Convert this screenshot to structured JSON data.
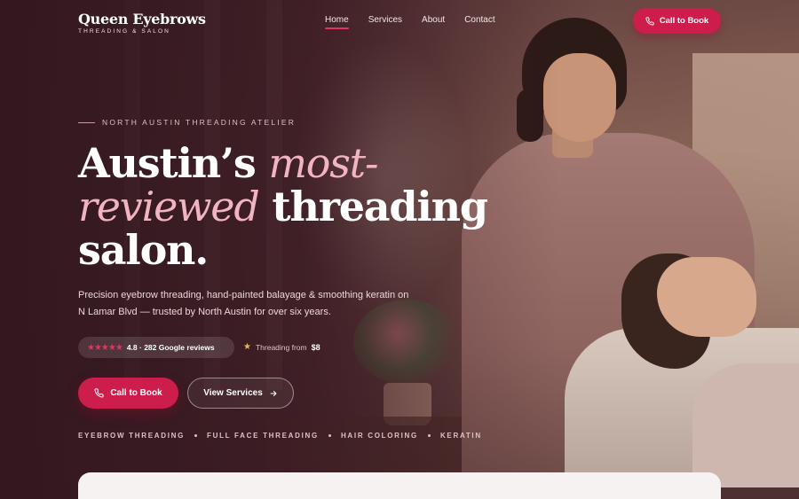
{
  "brand": {
    "name": "Queen Eyebrows",
    "tagline": "THREADING & SALON"
  },
  "nav": {
    "items": [
      {
        "label": "Home",
        "active": true
      },
      {
        "label": "Services",
        "active": false
      },
      {
        "label": "About",
        "active": false
      },
      {
        "label": "Contact",
        "active": false
      }
    ]
  },
  "header_cta": {
    "label": "Call to Book",
    "icon": "phone-icon"
  },
  "hero": {
    "eyebrow": "NORTH AUSTIN THREADING ATELIER",
    "headline": {
      "part1": "Austin’s",
      "accent1": "most-",
      "accent2": "reviewed",
      "part2": "threading",
      "part3": "salon."
    },
    "subhead": "Precision eyebrow threading, hand-painted balayage & smoothing keratin on N Lamar Blvd — trusted by North Austin for over six years.",
    "rating": {
      "stars": "★★★★★",
      "text": "4.8 · 282 Google reviews"
    },
    "price": {
      "label": "Threading from",
      "value": "$8"
    },
    "primary_button": {
      "label": "Call to Book",
      "icon": "phone-icon"
    },
    "secondary_button": {
      "label": "View Services",
      "icon": "arrow-right-icon"
    },
    "services": [
      "EYEBROW THREADING",
      "FULL FACE THREADING",
      "HAIR COLORING",
      "KERATIN"
    ]
  },
  "colors": {
    "accent": "#cd1d4d",
    "accent_soft": "#f2b4c0",
    "background": "#3a1f24"
  }
}
